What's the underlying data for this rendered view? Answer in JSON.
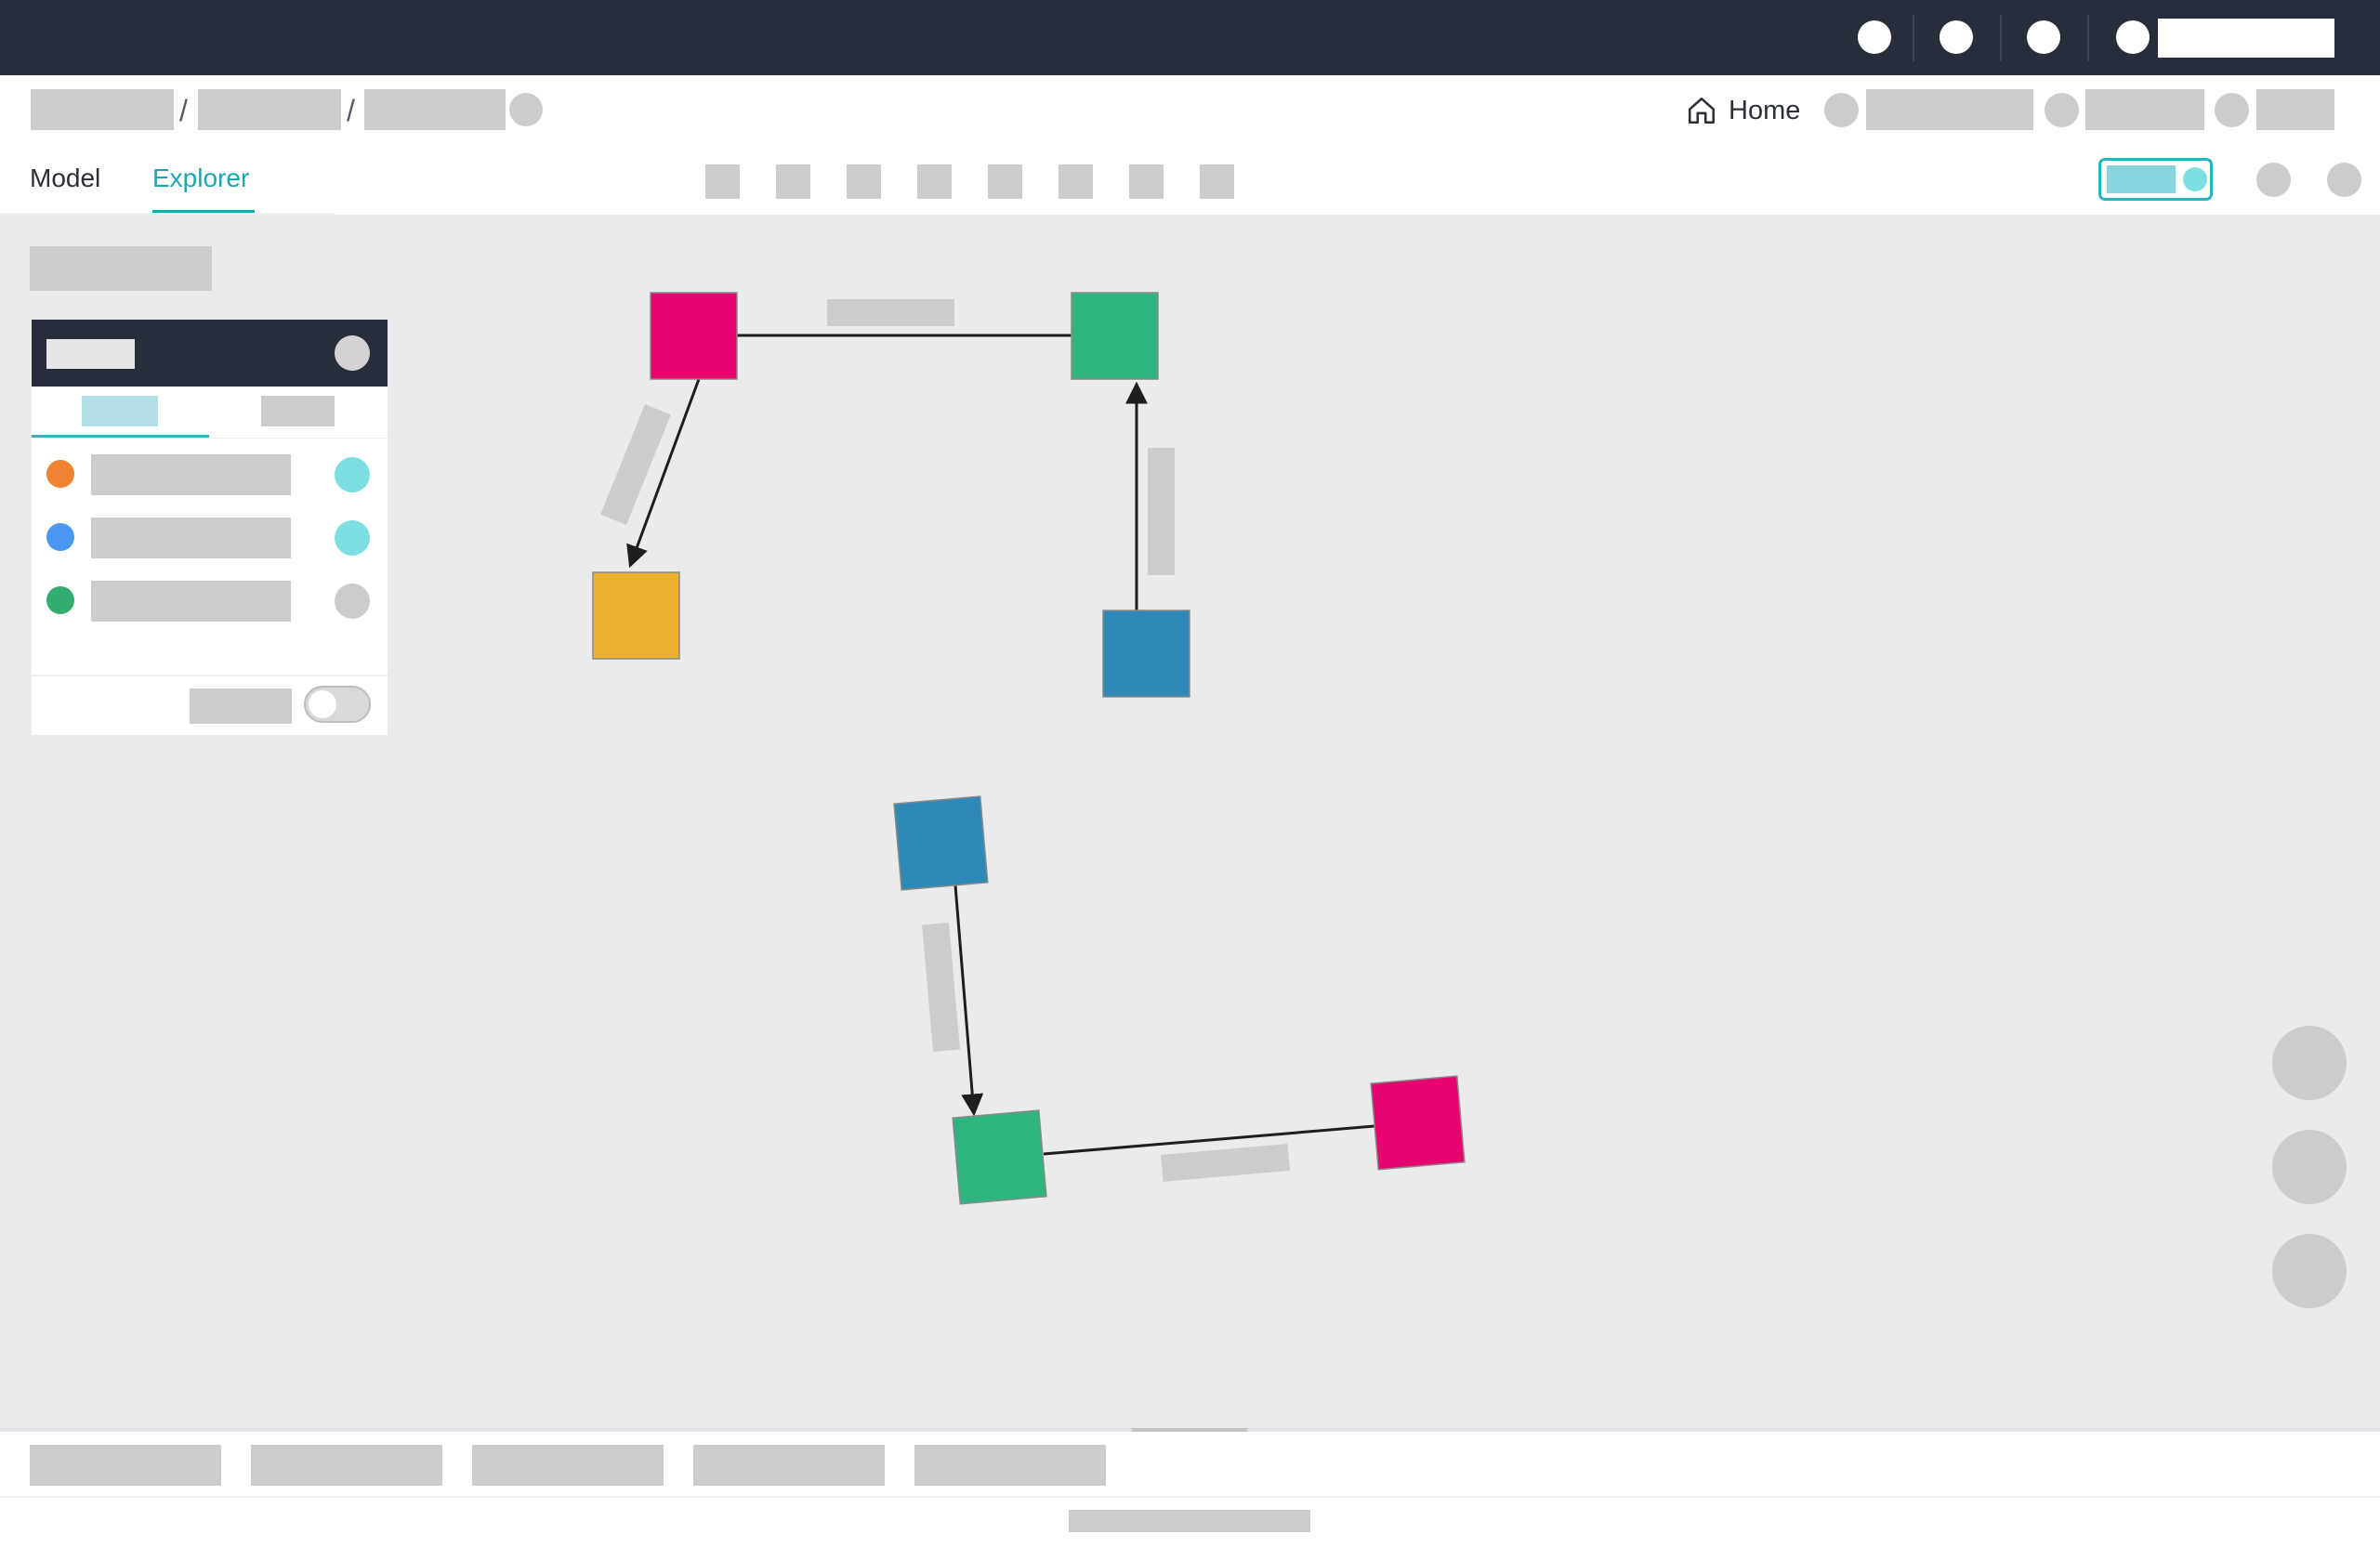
{
  "header": {
    "icons": [
      "help-icon",
      "notifications-icon",
      "settings-icon",
      "user-icon"
    ]
  },
  "breadcrumb": {
    "home_label": "Home",
    "separator": "/"
  },
  "tabs": [
    {
      "label": "Model",
      "active": false
    },
    {
      "label": "Explorer",
      "active": true
    }
  ],
  "toolbar": {
    "tool_count": 8
  },
  "legend": {
    "items": [
      {
        "color": "#f08332"
      },
      {
        "color": "#4a97f2"
      },
      {
        "color": "#33ac6f"
      }
    ],
    "status_colors": [
      "#7ddfe2",
      "#7ddfe2",
      "#cccccc"
    ]
  },
  "graph": {
    "node_colors": {
      "pink": "#e6056f",
      "green": "#2eb57e",
      "yellow": "#ebb12e",
      "blue": "#2f89b8"
    },
    "edge_color": "#1e1e1e",
    "edges": [
      {
        "from": "pink-node-1",
        "to": "yellow-node",
        "directed": true
      },
      {
        "from": "pink-node-1",
        "to": "green-node-1",
        "directed": false
      },
      {
        "from": "blue-node-1",
        "to": "green-node-1",
        "directed": true
      },
      {
        "from": "blue-node-2",
        "to": "green-node-2",
        "directed": true
      },
      {
        "from": "green-node-2",
        "to": "pink-node-2",
        "directed": false
      }
    ]
  },
  "colors": {
    "topbar": "#282d3c",
    "accent": "#1ba6b2",
    "canvas": "#eaebed",
    "placeholder": "#cccccc"
  }
}
